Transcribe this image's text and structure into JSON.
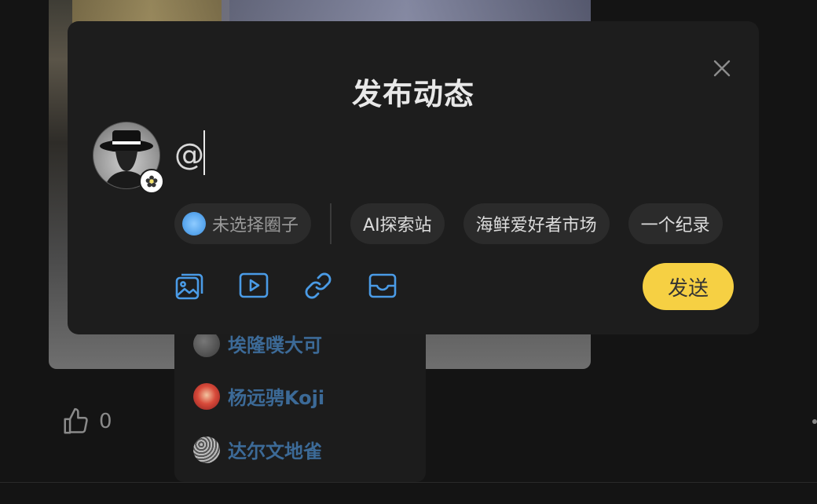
{
  "modal": {
    "title": "发布动态",
    "input_value": "@",
    "circle_none_label": "未选择圈子",
    "circles": [
      "AI探索站",
      "海鲜爱好者市场",
      "一个纪录"
    ],
    "send_label": "发送",
    "tools": [
      "image-icon",
      "video-icon",
      "link-icon",
      "inbox-icon"
    ],
    "accent_color": "#f6d043",
    "icon_color": "#4a9be6"
  },
  "mention_list": {
    "users": [
      {
        "name": "埃隆噗大可",
        "avatar": "avatar-gray"
      },
      {
        "name": "杨远骋Koji",
        "avatar": "avatar-red"
      },
      {
        "name": "达尔文地雀",
        "avatar": "avatar-pattern"
      }
    ]
  },
  "post": {
    "like_count": "0"
  }
}
